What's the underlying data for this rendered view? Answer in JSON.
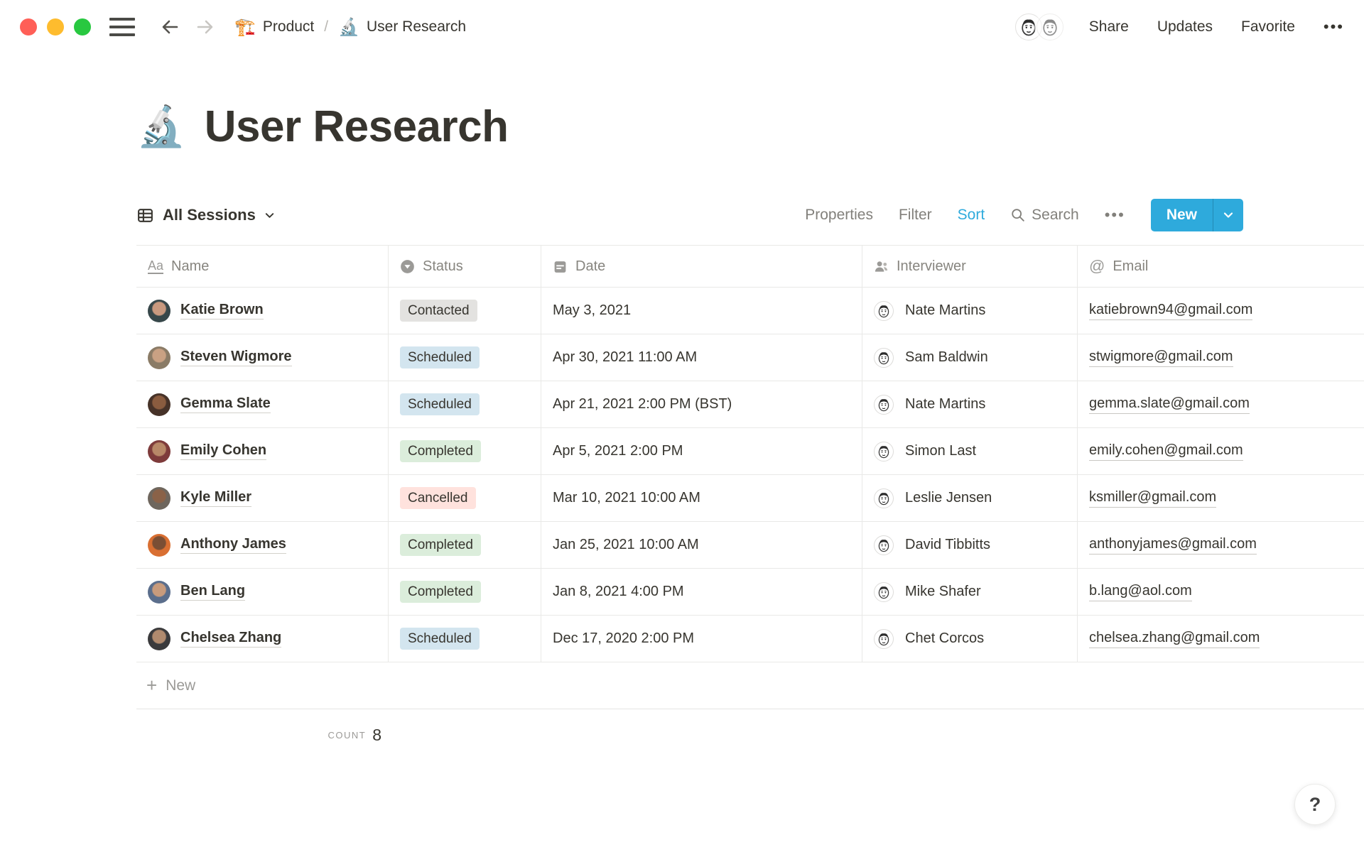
{
  "topbar": {
    "breadcrumb_product_icon": "🏗️",
    "breadcrumb_product": "Product",
    "breadcrumb_divider": "/",
    "breadcrumb_page_icon": "🔬",
    "breadcrumb_page": "User Research",
    "share": "Share",
    "updates": "Updates",
    "favorite": "Favorite",
    "more": "•••"
  },
  "title": {
    "icon": "🔬",
    "text": "User Research"
  },
  "toolbar": {
    "view_name": "All Sessions",
    "properties": "Properties",
    "filter": "Filter",
    "sort": "Sort",
    "search": "Search",
    "more": "•••",
    "new_label": "New"
  },
  "table": {
    "columns": [
      {
        "label": "Name",
        "icon": "title-icon",
        "icon_glyph": "Aa"
      },
      {
        "label": "Status",
        "icon": "select-icon"
      },
      {
        "label": "Date",
        "icon": "calendar-icon"
      },
      {
        "label": "Interviewer",
        "icon": "person-icon"
      },
      {
        "label": "Email",
        "icon": "email-icon",
        "icon_glyph": "@"
      }
    ],
    "rows": [
      {
        "name": "Katie Brown",
        "status": "Contacted",
        "status_color": "gray",
        "date": "May 3, 2021",
        "interviewer": "Nate Martins",
        "email": "katiebrown94@gmail.com"
      },
      {
        "name": "Steven Wigmore",
        "status": "Scheduled",
        "status_color": "blue",
        "date": "Apr 30, 2021 11:00 AM",
        "interviewer": "Sam Baldwin",
        "email": "stwigmore@gmail.com"
      },
      {
        "name": "Gemma Slate",
        "status": "Scheduled",
        "status_color": "blue",
        "date": "Apr 21, 2021 2:00 PM (BST)",
        "interviewer": "Nate Martins",
        "email": "gemma.slate@gmail.com"
      },
      {
        "name": "Emily Cohen",
        "status": "Completed",
        "status_color": "green",
        "date": "Apr 5, 2021 2:00 PM",
        "interviewer": "Simon Last",
        "email": "emily.cohen@gmail.com"
      },
      {
        "name": "Kyle Miller",
        "status": "Cancelled",
        "status_color": "red",
        "date": "Mar 10, 2021 10:00 AM",
        "interviewer": "Leslie Jensen",
        "email": "ksmiller@gmail.com"
      },
      {
        "name": "Anthony James",
        "status": "Completed",
        "status_color": "green",
        "date": "Jan 25, 2021 10:00 AM",
        "interviewer": "David Tibbitts",
        "email": "anthonyjames@gmail.com"
      },
      {
        "name": "Ben Lang",
        "status": "Completed",
        "status_color": "green",
        "date": "Jan 8, 2021 4:00 PM",
        "interviewer": "Mike Shafer",
        "email": "b.lang@aol.com"
      },
      {
        "name": "Chelsea Zhang",
        "status": "Scheduled",
        "status_color": "blue",
        "date": "Dec 17, 2020 2:00 PM",
        "interviewer": "Chet Corcos",
        "email": "chelsea.zhang@gmail.com"
      }
    ],
    "new_row_label": "New",
    "count_label": "count",
    "count_value": "8"
  },
  "help": {
    "label": "?"
  },
  "colors": {
    "accent": "#2EAADC",
    "badge_gray": "#E3E2E0",
    "badge_blue": "#D3E5EF",
    "badge_green": "#DBEDDB",
    "badge_red": "#FFE2DD",
    "traffic_red": "#FF5F57",
    "traffic_yellow": "#FEBC2E",
    "traffic_green": "#28C840"
  }
}
